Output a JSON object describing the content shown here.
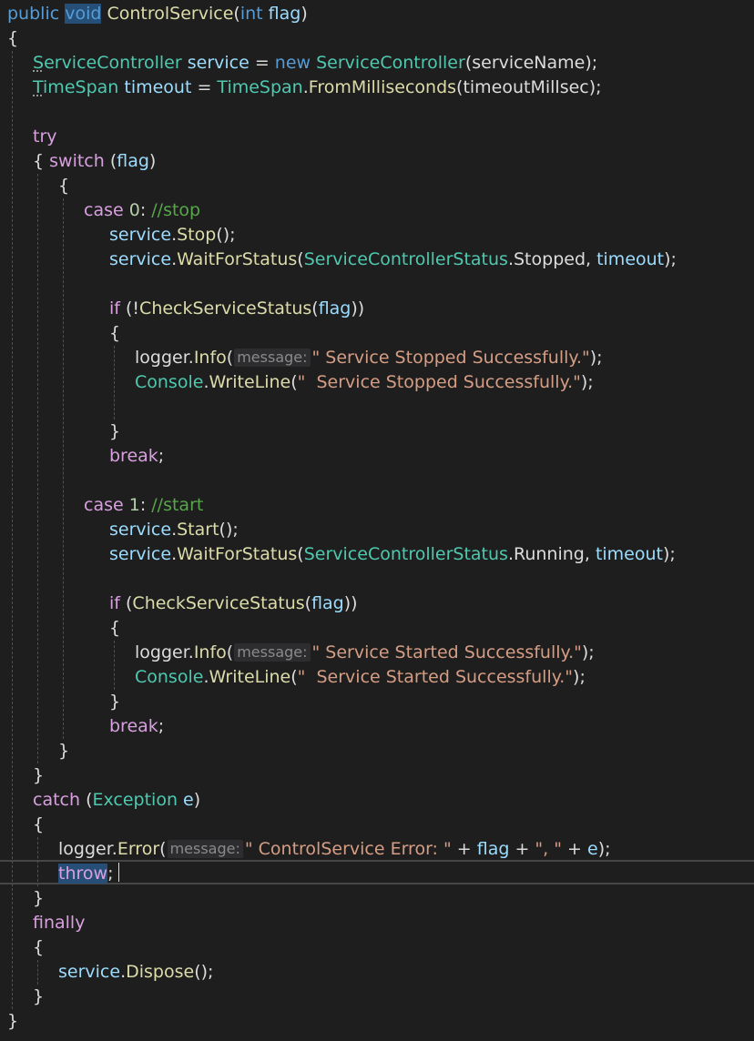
{
  "editor": {
    "language": "C#",
    "theme": {
      "background": "#1e1e1e",
      "keyword": "#569cd6",
      "control_keyword": "#d8a0df",
      "type": "#4ec9b0",
      "method": "#dcdcaa",
      "string": "#d69d85",
      "variable": "#9cdcfe",
      "comment": "#57a64a",
      "selection": "#264f78"
    },
    "current_line": 36,
    "lines": [
      [
        [
          "kw",
          "public "
        ],
        [
          "kw-sel",
          "void"
        ],
        [
          "plain",
          " "
        ],
        [
          "meth",
          "ControlService"
        ],
        [
          "plain",
          "("
        ],
        [
          "kw",
          "int"
        ],
        [
          "plain",
          " "
        ],
        [
          "var",
          "flag"
        ],
        [
          "plain",
          ")"
        ]
      ],
      [
        [
          "plain",
          "{"
        ]
      ],
      [
        [
          "type-sq",
          "S"
        ],
        [
          "type",
          "erviceController"
        ],
        [
          "plain",
          " "
        ],
        [
          "var",
          "service"
        ],
        [
          "plain",
          " = "
        ],
        [
          "kw",
          "new"
        ],
        [
          "plain",
          " "
        ],
        [
          "type",
          "ServiceController"
        ],
        [
          "plain",
          "(serviceName);"
        ]
      ],
      [
        [
          "type-sq",
          "T"
        ],
        [
          "type",
          "imeSpan"
        ],
        [
          "plain",
          " "
        ],
        [
          "var",
          "timeout"
        ],
        [
          "plain",
          " = "
        ],
        [
          "type",
          "TimeSpan"
        ],
        [
          "plain",
          "."
        ],
        [
          "meth",
          "FromMilliseconds"
        ],
        [
          "plain",
          "(timeoutMillsec);"
        ]
      ],
      [],
      [
        [
          "ctl",
          "try"
        ]
      ],
      [
        [
          "plain",
          "{ "
        ],
        [
          "ctl",
          "switch"
        ],
        [
          "plain",
          " ("
        ],
        [
          "var",
          "flag"
        ],
        [
          "plain",
          ")"
        ]
      ],
      [
        [
          "plain",
          "{"
        ]
      ],
      [
        [
          "ctl",
          "case"
        ],
        [
          "plain",
          " "
        ],
        [
          "num",
          "0"
        ],
        [
          "plain",
          ": "
        ],
        [
          "cmt",
          "//stop"
        ]
      ],
      [
        [
          "var",
          "service"
        ],
        [
          "plain",
          "."
        ],
        [
          "meth",
          "Stop"
        ],
        [
          "plain",
          "();"
        ]
      ],
      [
        [
          "var",
          "service"
        ],
        [
          "plain",
          "."
        ],
        [
          "meth",
          "WaitForStatus"
        ],
        [
          "plain",
          "("
        ],
        [
          "type",
          "ServiceControllerStatus"
        ],
        [
          "plain",
          ".Stopped, "
        ],
        [
          "var",
          "timeout"
        ],
        [
          "plain",
          ");"
        ]
      ],
      [],
      [
        [
          "ctl",
          "if"
        ],
        [
          "plain",
          " (!"
        ],
        [
          "meth",
          "CheckServiceStatus"
        ],
        [
          "plain",
          "("
        ],
        [
          "var",
          "flag"
        ],
        [
          "plain",
          "))"
        ]
      ],
      [
        [
          "plain",
          "{"
        ]
      ],
      [
        [
          "plain",
          "logger."
        ],
        [
          "meth",
          "Info"
        ],
        [
          "plain",
          "("
        ],
        [
          "hint",
          "message:"
        ],
        [
          "str",
          "\" Service Stopped Successfully.\""
        ],
        [
          "plain",
          ");"
        ]
      ],
      [
        [
          "type",
          "Console"
        ],
        [
          "plain",
          "."
        ],
        [
          "meth",
          "WriteLine"
        ],
        [
          "plain",
          "("
        ],
        [
          "str",
          "\"  Service Stopped Successfully.\""
        ],
        [
          "plain",
          ");"
        ]
      ],
      [],
      [
        [
          "plain",
          "}"
        ]
      ],
      [
        [
          "ctl",
          "break"
        ],
        [
          "plain",
          ";"
        ]
      ],
      [],
      [
        [
          "ctl",
          "case"
        ],
        [
          "plain",
          " "
        ],
        [
          "num",
          "1"
        ],
        [
          "plain",
          ": "
        ],
        [
          "cmt",
          "//start"
        ]
      ],
      [
        [
          "var",
          "service"
        ],
        [
          "plain",
          "."
        ],
        [
          "meth",
          "Start"
        ],
        [
          "plain",
          "();"
        ]
      ],
      [
        [
          "var",
          "service"
        ],
        [
          "plain",
          "."
        ],
        [
          "meth",
          "WaitForStatus"
        ],
        [
          "plain",
          "("
        ],
        [
          "type",
          "ServiceControllerStatus"
        ],
        [
          "plain",
          ".Running, "
        ],
        [
          "var",
          "timeout"
        ],
        [
          "plain",
          ");"
        ]
      ],
      [],
      [
        [
          "ctl",
          "if"
        ],
        [
          "plain",
          " ("
        ],
        [
          "meth",
          "CheckServiceStatus"
        ],
        [
          "plain",
          "("
        ],
        [
          "var",
          "flag"
        ],
        [
          "plain",
          "))"
        ]
      ],
      [
        [
          "plain",
          "{"
        ]
      ],
      [
        [
          "plain",
          "logger."
        ],
        [
          "meth",
          "Info"
        ],
        [
          "plain",
          "("
        ],
        [
          "hint",
          "message:"
        ],
        [
          "str",
          "\" Service Started Successfully.\""
        ],
        [
          "plain",
          ");"
        ]
      ],
      [
        [
          "type",
          "Console"
        ],
        [
          "plain",
          "."
        ],
        [
          "meth",
          "WriteLine"
        ],
        [
          "plain",
          "("
        ],
        [
          "str",
          "\"  Service Started Successfully.\""
        ],
        [
          "plain",
          ");"
        ]
      ],
      [
        [
          "plain",
          "}"
        ]
      ],
      [
        [
          "ctl",
          "break"
        ],
        [
          "plain",
          ";"
        ]
      ],
      [
        [
          "plain",
          "}"
        ]
      ],
      [
        [
          "plain",
          "}"
        ]
      ],
      [
        [
          "ctl",
          "catch"
        ],
        [
          "plain",
          " ("
        ],
        [
          "type",
          "Exception"
        ],
        [
          "plain",
          " "
        ],
        [
          "var",
          "e"
        ],
        [
          "plain",
          ")"
        ]
      ],
      [
        [
          "plain",
          "{"
        ]
      ],
      [
        [
          "plain",
          "logger."
        ],
        [
          "meth",
          "Error"
        ],
        [
          "plain",
          "("
        ],
        [
          "hint",
          "message:"
        ],
        [
          "str",
          "\" ControlService Error: \""
        ],
        [
          "plain",
          " + "
        ],
        [
          "var",
          "flag"
        ],
        [
          "plain",
          " + "
        ],
        [
          "str",
          "\", \""
        ],
        [
          "plain",
          " + "
        ],
        [
          "var",
          "e"
        ],
        [
          "plain",
          ");"
        ]
      ],
      [
        [
          "ctl-sel",
          "throw"
        ],
        [
          "plain",
          ";"
        ]
      ],
      [
        [
          "plain",
          "}"
        ]
      ],
      [
        [
          "ctl",
          "finally"
        ]
      ],
      [
        [
          "plain",
          "{"
        ]
      ],
      [
        [
          "var",
          "service"
        ],
        [
          "plain",
          "."
        ],
        [
          "meth",
          "Dispose"
        ],
        [
          "plain",
          "();"
        ]
      ],
      [
        [
          "plain",
          "}"
        ]
      ],
      [
        [
          "plain",
          "}"
        ]
      ]
    ]
  }
}
